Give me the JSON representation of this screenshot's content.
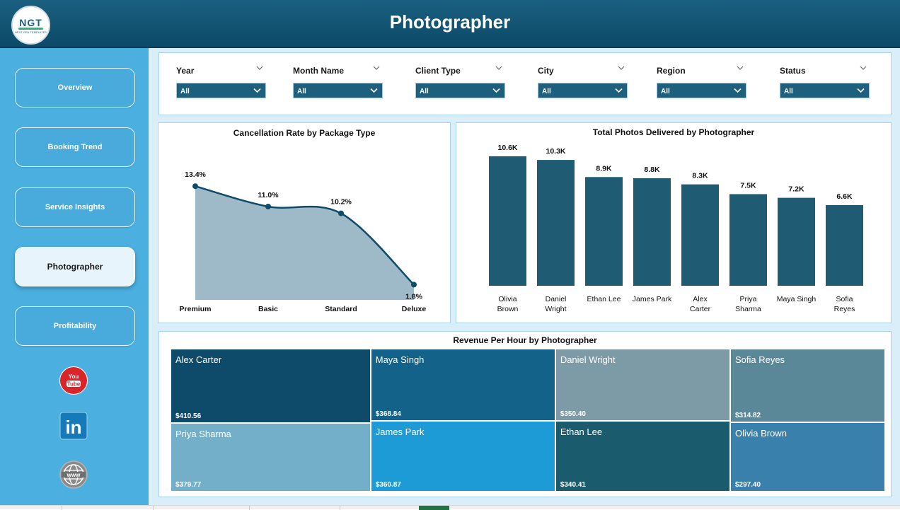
{
  "header": {
    "title": "Photographer",
    "logo_text": "NGT",
    "logo_subtext": "NEXT GEN TEMPLATES"
  },
  "sidebar": {
    "items": [
      {
        "label": "Overview",
        "active": false
      },
      {
        "label": "Booking Trend",
        "active": false
      },
      {
        "label": "Service Insights",
        "active": false
      },
      {
        "label": "Photographer",
        "active": true
      },
      {
        "label": "Profitability",
        "active": false
      }
    ],
    "social_icons": [
      "youtube-icon",
      "linkedin-icon",
      "website-globe-icon"
    ],
    "youtube_text": "You Tube",
    "linkedin_text": "in",
    "website_text": "www"
  },
  "filters": [
    {
      "label": "Year",
      "value": "All"
    },
    {
      "label": "Month Name",
      "value": "All"
    },
    {
      "label": "Client Type",
      "value": "All"
    },
    {
      "label": "City",
      "value": "All"
    },
    {
      "label": "Region",
      "value": "All"
    },
    {
      "label": "Status",
      "value": "All"
    }
  ],
  "charts": {
    "cancellation": {
      "title": "Cancellation Rate by Package Type"
    },
    "photos": {
      "title": "Total Photos Delivered by Photographer"
    },
    "revenue": {
      "title": "Revenue Per Hour by Photographer"
    }
  },
  "chart_data": [
    {
      "type": "area",
      "title": "Cancellation Rate by Package Type",
      "categories": [
        "Premium",
        "Basic",
        "Standard",
        "Deluxe"
      ],
      "values": [
        13.4,
        11.0,
        10.2,
        1.8
      ],
      "labels": [
        "13.4%",
        "11.0%",
        "10.2%",
        "1.8%"
      ],
      "unit": "%",
      "ylim": [
        0,
        15
      ],
      "grid": false,
      "colors": {
        "fill": "#9eb9c7",
        "line": "#0f4c6a",
        "marker": "#0f4c6a"
      }
    },
    {
      "type": "bar",
      "title": "Total Photos Delivered by Photographer",
      "categories": [
        "Olivia Brown",
        "Daniel Wright",
        "Ethan Lee",
        "James Park",
        "Alex Carter",
        "Priya Sharma",
        "Maya Singh",
        "Sofia Reyes"
      ],
      "values": [
        10600,
        10300,
        8900,
        8800,
        8300,
        7500,
        7200,
        6600
      ],
      "labels": [
        "10.6K",
        "10.3K",
        "8.9K",
        "8.8K",
        "8.3K",
        "7.5K",
        "7.2K",
        "6.6K"
      ],
      "ylim": [
        0,
        11000
      ],
      "grid": false,
      "colors": {
        "bar": "#1f5b73"
      }
    },
    {
      "type": "treemap",
      "title": "Revenue Per Hour by Photographer",
      "items": [
        {
          "name": "Alex Carter",
          "value": 410.56,
          "label": "$410.56",
          "color": "#0e4b6a"
        },
        {
          "name": "Priya Sharma",
          "value": 379.77,
          "label": "$379.77",
          "color": "#73afc9"
        },
        {
          "name": "Maya Singh",
          "value": 368.84,
          "label": "$368.84",
          "color": "#12628a"
        },
        {
          "name": "James Park",
          "value": 360.87,
          "label": "$360.87",
          "color": "#1d9bd6"
        },
        {
          "name": "Daniel Wright",
          "value": 350.4,
          "label": "$350.40",
          "color": "#7d9aa7"
        },
        {
          "name": "Ethan Lee",
          "value": 340.41,
          "label": "$340.41",
          "color": "#1a5c6d"
        },
        {
          "name": "Sofia Reyes",
          "value": 314.82,
          "label": "$314.82",
          "color": "#5a8899"
        },
        {
          "name": "Olivia Brown",
          "value": 297.4,
          "label": "$297.40",
          "color": "#3a80ad"
        }
      ]
    }
  ]
}
